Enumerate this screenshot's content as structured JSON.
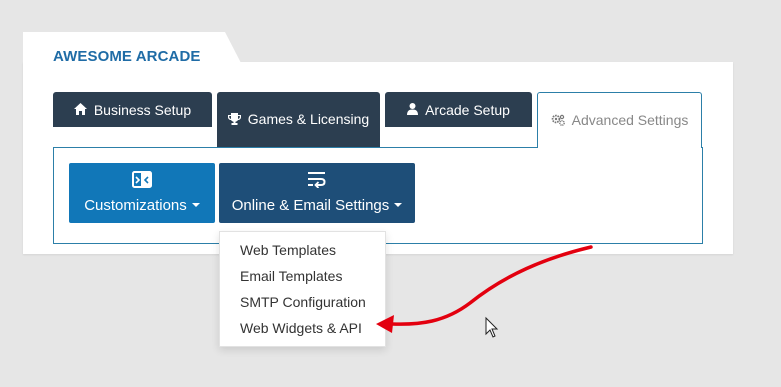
{
  "app": {
    "title": "AWESOME ARCADE"
  },
  "tabs": [
    {
      "label": "Business Setup",
      "icon": "home-icon",
      "active": false
    },
    {
      "label": "Games & Licensing",
      "icon": "trophy-icon",
      "active": false
    },
    {
      "label": "Arcade Setup",
      "icon": "user-icon",
      "active": false
    },
    {
      "label": "Advanced Settings",
      "icon": "gears-icon",
      "active": true
    }
  ],
  "subnav": {
    "customizations": {
      "label": "Customizations",
      "icon": "customize-icon"
    },
    "online_email": {
      "label": "Online & Email Settings",
      "icon": "wrap-arrow-icon"
    }
  },
  "dropdown": {
    "items": [
      "Web Templates",
      "Email Templates",
      "SMTP Configuration",
      "Web Widgets & API"
    ]
  },
  "colors": {
    "title": "#1f6ca6",
    "tab_dark": "#2c3e50",
    "btn_customizations": "#1177b8",
    "btn_online": "#1e4e78",
    "annotation_arrow": "#e3000f"
  }
}
